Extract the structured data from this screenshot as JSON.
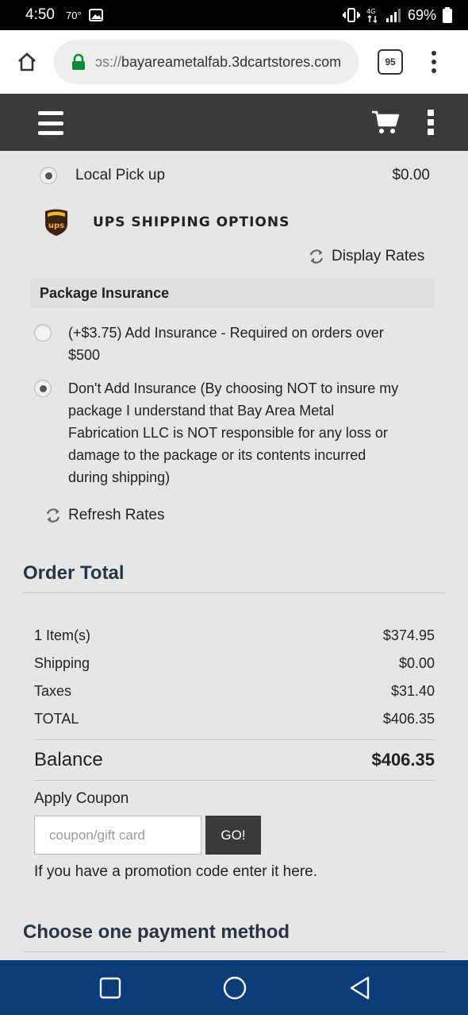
{
  "status_bar": {
    "time": "4:50",
    "temp": "70°",
    "battery": "69%",
    "icons": [
      "gallery-icon",
      "vibrate-icon",
      "data-icon",
      "signal-icon",
      "battery-icon"
    ]
  },
  "browser": {
    "url_prefix": "ɔs://",
    "url_host": "bayareametalfab.3dcartstores.com",
    "tab_count": "95"
  },
  "shipping": {
    "local_pickup_label": "Local Pick up",
    "local_pickup_price": "$0.00",
    "local_pickup_selected": true,
    "ups_title": "UPS SHIPPING OPTIONS",
    "display_rates": "Display Rates"
  },
  "insurance": {
    "header": "Package Insurance",
    "options": [
      {
        "label": "(+$3.75) Add Insurance - Required on orders over $500",
        "selected": false
      },
      {
        "label": "Don't Add Insurance (By choosing NOT to insure my package I understand that Bay Area Metal Fabrication LLC is NOT responsible for any loss or damage to the package or its contents incurred during shipping)",
        "selected": true
      }
    ],
    "refresh_rates": "Refresh Rates"
  },
  "order_total": {
    "title": "Order Total",
    "rows": [
      {
        "label": "1 Item(s)",
        "value": "$374.95"
      },
      {
        "label": "Shipping",
        "value": "$0.00"
      },
      {
        "label": "Taxes",
        "value": "$31.40"
      },
      {
        "label": "TOTAL",
        "value": "$406.35"
      }
    ],
    "balance_label": "Balance",
    "balance_value": "$406.35"
  },
  "coupon": {
    "label": "Apply Coupon",
    "placeholder": "coupon/gift card",
    "value": "",
    "button": "GO!",
    "hint": "If you have a promotion code enter it here."
  },
  "payment": {
    "title": "Choose one payment method"
  },
  "colors": {
    "page_bg": "#e6e6e6",
    "header_bg": "#3a3a3a",
    "nav_bar_bg": "#0c3b7a",
    "heading": "#2a3540",
    "lock_green": "#0a8a3a"
  }
}
